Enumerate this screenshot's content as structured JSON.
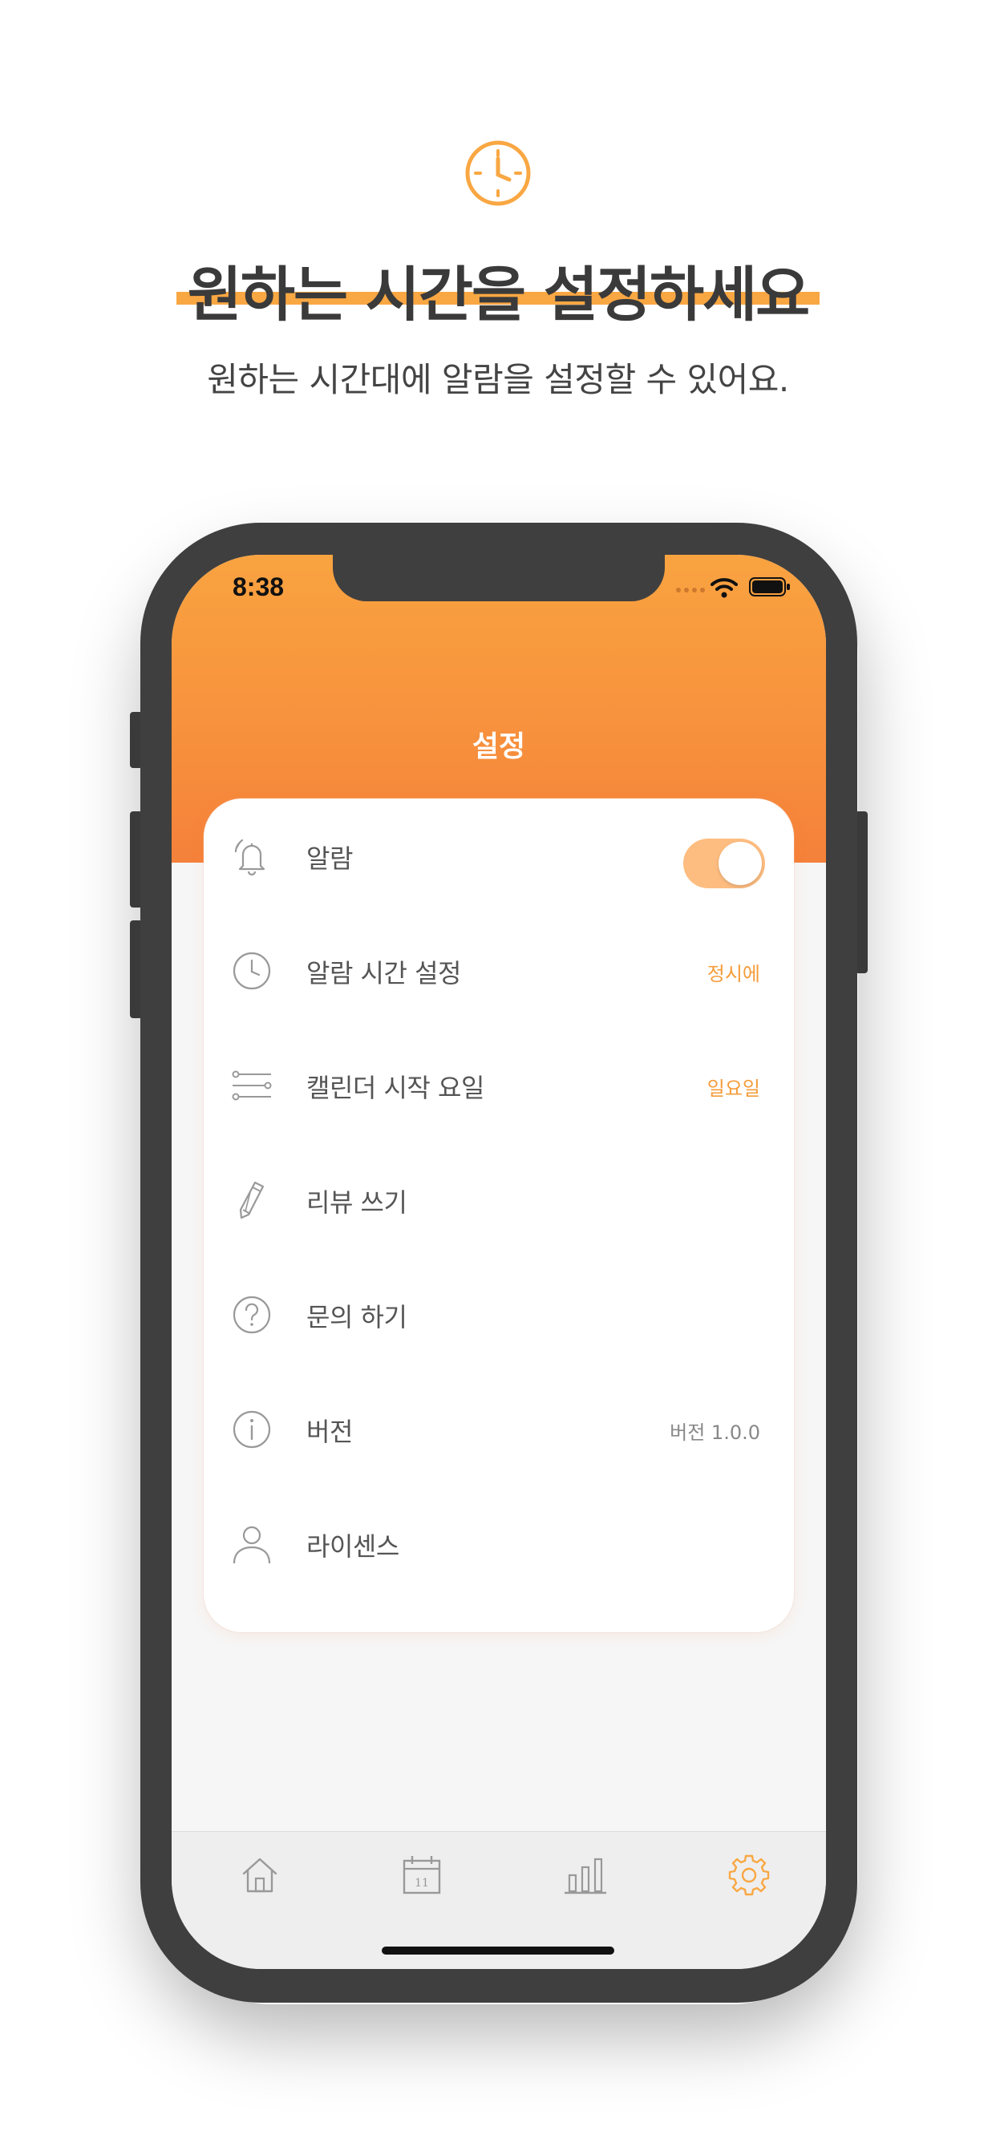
{
  "promo": {
    "icon": "clock-icon",
    "title": "원하는 시간을 설정하세요",
    "subtitle": "원하는 시간대에 알람을 설정할 수 있어요."
  },
  "status_bar": {
    "time": "8:38",
    "icons": [
      "wifi-icon",
      "battery-icon"
    ]
  },
  "nav": {
    "title": "설정"
  },
  "settings": {
    "items": [
      {
        "icon": "bell-icon",
        "label": "알람",
        "control": "toggle",
        "toggle_on": true
      },
      {
        "icon": "clock-icon",
        "label": "알람 시간 설정",
        "value": "정시에"
      },
      {
        "icon": "sliders-icon",
        "label": "캘린더 시작 요일",
        "value": "일요일"
      },
      {
        "icon": "pencil-icon",
        "label": "리뷰 쓰기"
      },
      {
        "icon": "question-icon",
        "label": "문의 하기"
      },
      {
        "icon": "info-icon",
        "label": "버전",
        "value": "버전 1.0.0"
      },
      {
        "icon": "person-icon",
        "label": "라이센스"
      }
    ]
  },
  "tabbar": {
    "tabs": [
      {
        "icon": "home-icon",
        "active": false
      },
      {
        "icon": "calendar-icon",
        "date": "11",
        "active": false
      },
      {
        "icon": "bar-chart-icon",
        "active": false
      },
      {
        "icon": "gear-icon",
        "active": true
      }
    ]
  },
  "colors": {
    "accent": "#f9a743",
    "header_top": "#f9a340",
    "header_bottom": "#f5813a",
    "toggle_on": "#fdbd80",
    "icon_gray": "#999999"
  }
}
